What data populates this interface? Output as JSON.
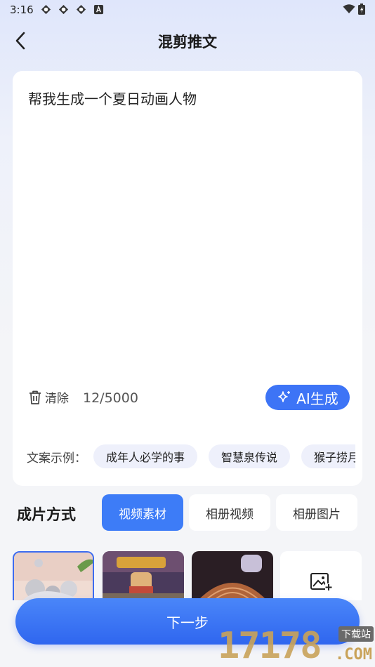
{
  "status": {
    "time": "3:16"
  },
  "header": {
    "title": "混剪推文"
  },
  "editor": {
    "prompt": "帮我生成一个夏日动画人物",
    "clear_label": "清除",
    "counter": "12/5000",
    "ai_label": "AI生成"
  },
  "examples": {
    "label": "文案示例：",
    "items": [
      "成年人必学的事",
      "智慧泉传说",
      "猴子捞月亮"
    ]
  },
  "mode": {
    "label": "成片方式",
    "options": [
      "视频素材",
      "相册视频",
      "相册图片"
    ],
    "selected": "视频素材"
  },
  "footer": {
    "next_label": "下一步"
  },
  "watermark": {
    "number": "17178",
    "tag": "下载站",
    "suffix": ".COM"
  },
  "colors": {
    "accent": "#3d74f6",
    "chip_bg": "#eef0fb"
  }
}
